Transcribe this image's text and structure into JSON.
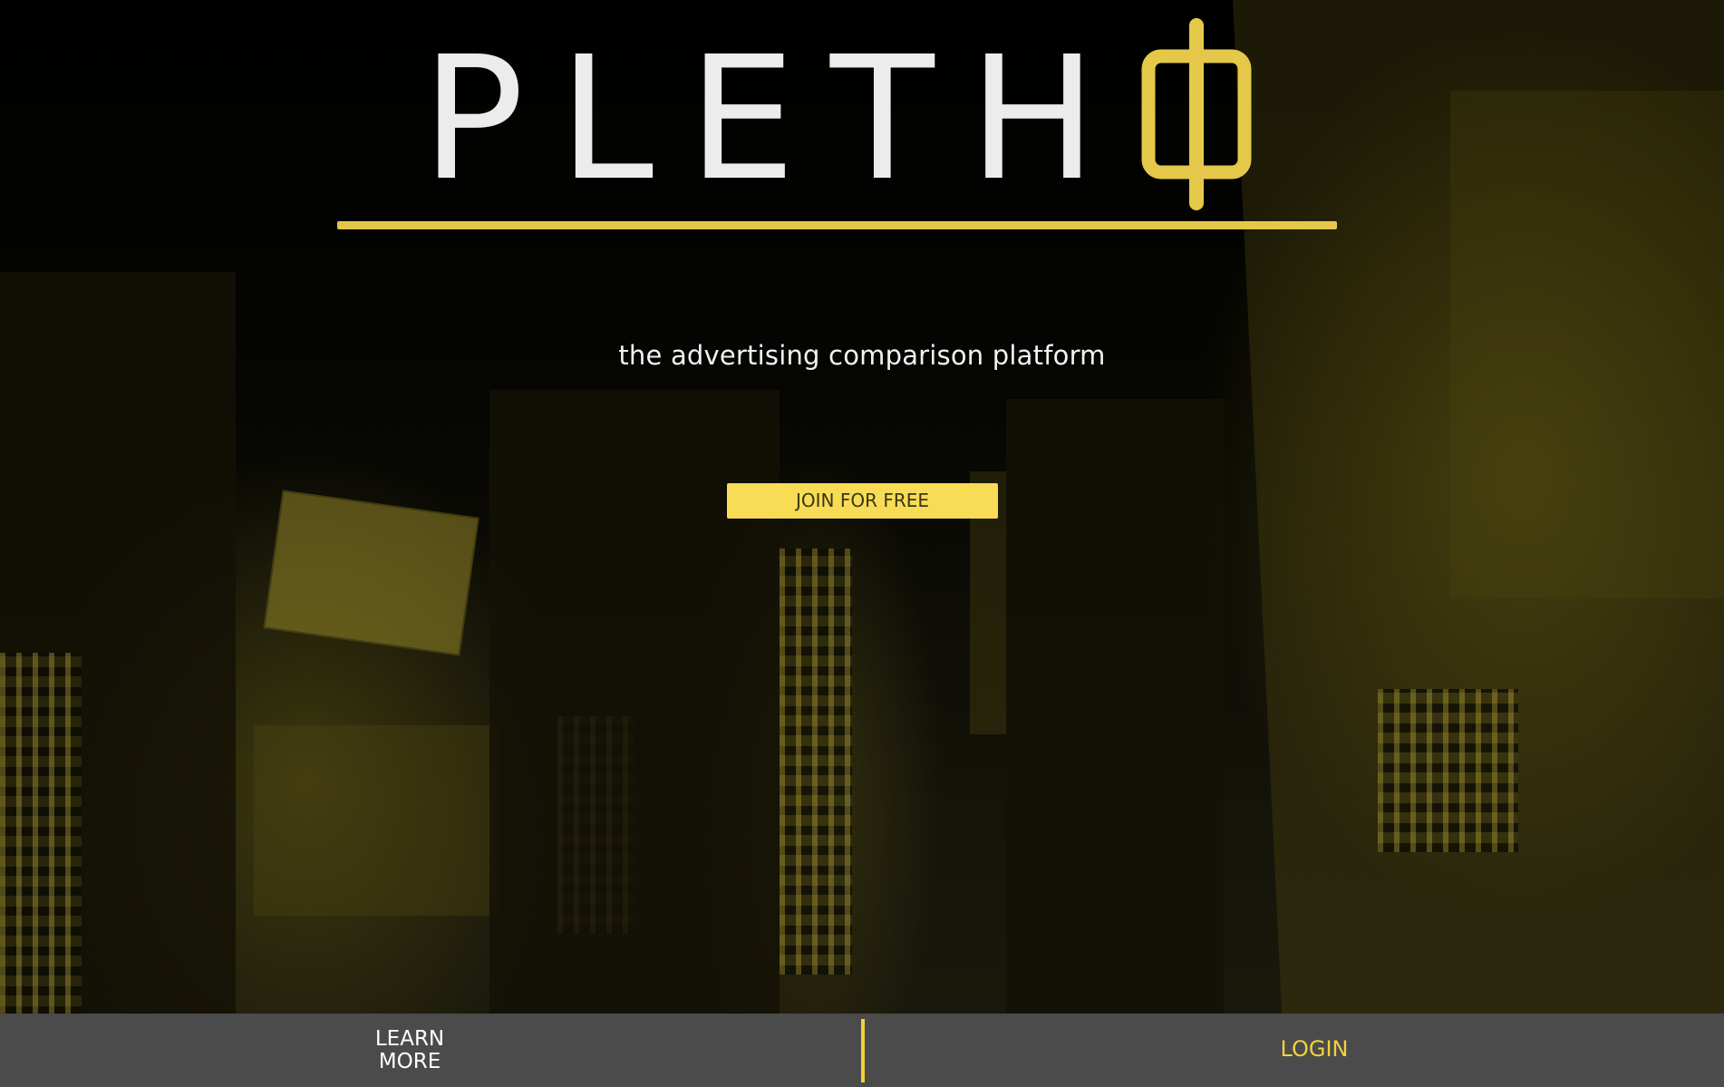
{
  "logo": {
    "text": "PLETH",
    "mark": "O",
    "colors": {
      "letters": "#ececec",
      "accent": "#e5c84a"
    }
  },
  "tagline": "the advertising comparison platform",
  "cta": {
    "label": "JOIN FOR FREE",
    "color": "#f8dc55"
  },
  "footer": {
    "learn_more_line1": "LEARN",
    "learn_more_line2": "MORE",
    "login_label": "LOGIN",
    "background": "#4b4b4b",
    "accent": "#f2d23c"
  },
  "background": {
    "description_icon": "city-night-photo"
  }
}
